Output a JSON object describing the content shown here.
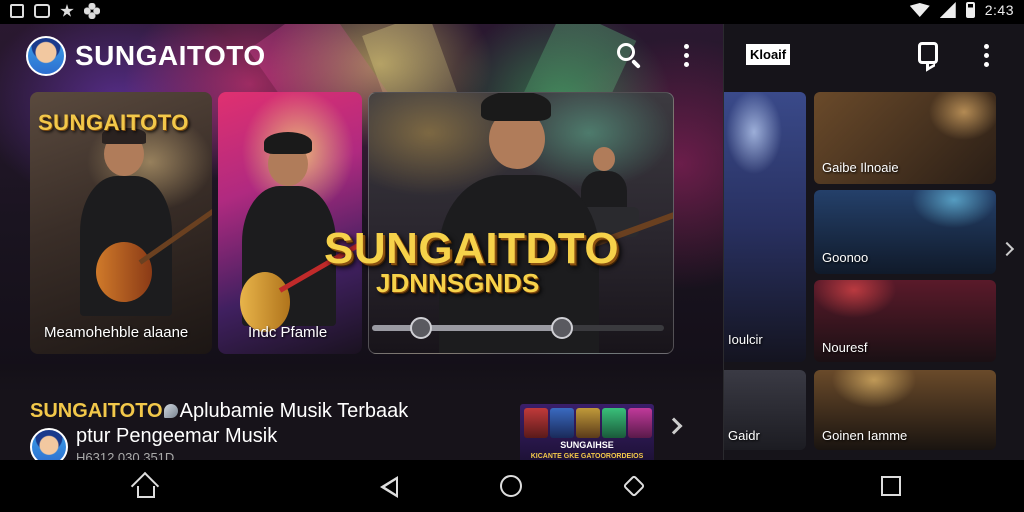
{
  "status_bar": {
    "time": "2:43"
  },
  "header": {
    "brand": "SUNGAITOTO",
    "icons": [
      "search-icon",
      "more-vert-icon"
    ]
  },
  "cards": [
    {
      "overlay_title": "SUNGAITOTO",
      "caption": "Meamohehble alaane"
    },
    {
      "caption": "Indc Pfamle"
    },
    {
      "overlay_title": "SUNGAITDTO",
      "overlay_subtitle": "JDNNSGNDS",
      "progress": 0.65
    }
  ],
  "featured": {
    "brand": "SUNGAITOTO",
    "headline_line1": "Aplubamie Musik Terbaak",
    "headline_line2": "ptur Pengeemar Musik",
    "meta": "H6312 030 351D",
    "thumbnail_title": "SUNGAIHSE",
    "thumbnail_subtitle": "KICANTE GKE GATOORORDEIOS"
  },
  "side_panel": {
    "logo_text": "Kloaif",
    "left_captions": [
      "Ioulcir",
      "Gaidr"
    ],
    "tiles": [
      {
        "caption": "Gaibe Ilnoaie"
      },
      {
        "caption": "Goonoo"
      },
      {
        "caption": "Nouresf"
      },
      {
        "caption": "Goinen Iamme"
      }
    ]
  },
  "colors": {
    "accent_gold": "#f2c84a",
    "background": "#17131a"
  }
}
